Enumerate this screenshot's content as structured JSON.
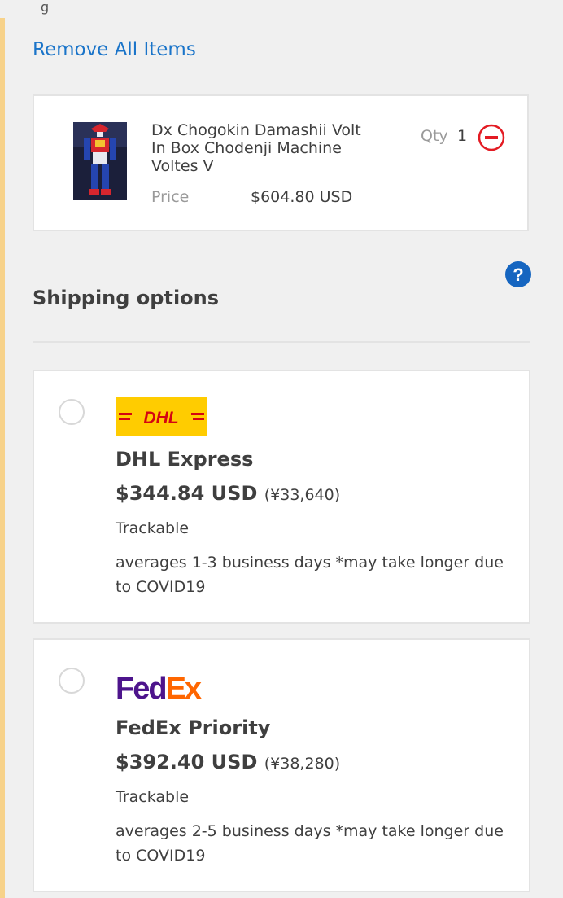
{
  "header": {
    "top_fragment": "g",
    "remove_all_label": "Remove All Items"
  },
  "cart_item": {
    "title": "Dx Chogokin Damashii Volt In Box Chodenji Machine Voltes V",
    "price_label": "Price",
    "price_value": "$604.80 USD",
    "qty_label": "Qty",
    "qty_value": "1"
  },
  "shipping": {
    "title": "Shipping options",
    "options": [
      {
        "logo_text": "DHL",
        "name": "DHL Express",
        "price": "$344.84 USD",
        "price_jpy": "(¥33,640)",
        "trackable": "Trackable",
        "averages": "averages 1-3 business days *may take longer due to COVID19"
      },
      {
        "logo_text_fed": "Fed",
        "logo_text_ex": "Ex",
        "name": "FedEx Priority",
        "price": "$392.40 USD",
        "price_jpy": "(¥38,280)",
        "trackable": "Trackable",
        "averages": "averages 2-5 business days *may take longer due to COVID19"
      }
    ]
  },
  "colors": {
    "link": "#1a74c9",
    "remove_red": "#e31b23",
    "help_blue": "#1565c0",
    "dhl_yellow": "#ffcc00",
    "dhl_red": "#d40511",
    "fedex_purple": "#4d148c",
    "fedex_orange": "#ff6600",
    "accent_left": "#f7d28a"
  }
}
